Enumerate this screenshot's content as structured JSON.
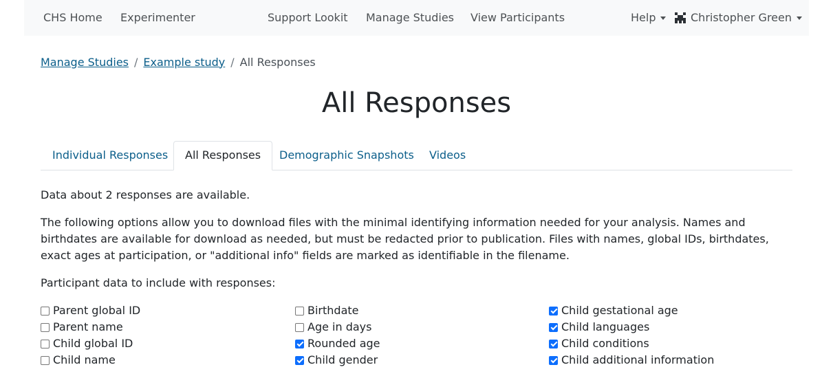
{
  "navbar": {
    "chs_home": "CHS Home",
    "experimenter": "Experimenter",
    "support": "Support Lookit",
    "manage_studies": "Manage Studies",
    "view_participants": "View Participants",
    "help": "Help",
    "user_name": "Christopher Green"
  },
  "breadcrumb": {
    "item1": "Manage Studies",
    "item2": "Example study",
    "current": "All Responses",
    "separator": "/"
  },
  "page_title": "All Responses",
  "tabs": [
    {
      "label": "Individual Responses",
      "active": false
    },
    {
      "label": "All Responses",
      "active": true
    },
    {
      "label": "Demographic Snapshots",
      "active": false
    },
    {
      "label": "Videos",
      "active": false
    }
  ],
  "summary": "Data about 2 responses are available.",
  "description": "The following options allow you to download files with the minimal identifying information needed for your analysis. Names and birthdates are available for download as needed, but must be redacted prior to publication. Files with names, global IDs, birthdates, exact ages at participation, or \"additional info\" fields are marked as identifiable in the filename.",
  "include_label": "Participant data to include with responses:",
  "options": {
    "col1": [
      {
        "label": "Parent global ID",
        "checked": false
      },
      {
        "label": "Parent name",
        "checked": false
      },
      {
        "label": "Child global ID",
        "checked": false
      },
      {
        "label": "Child name",
        "checked": false
      }
    ],
    "col2": [
      {
        "label": "Birthdate",
        "checked": false
      },
      {
        "label": "Age in days",
        "checked": false
      },
      {
        "label": "Rounded age",
        "checked": true
      },
      {
        "label": "Child gender",
        "checked": true
      }
    ],
    "col3": [
      {
        "label": "Child gestational age",
        "checked": true
      },
      {
        "label": "Child languages",
        "checked": true
      },
      {
        "label": "Child conditions",
        "checked": true
      },
      {
        "label": "Child additional information",
        "checked": true
      }
    ]
  },
  "colors": {
    "navbar_bg": "#f8f9fa",
    "link": "#0b5e8a",
    "checkbox_checked": "#0d6efd",
    "text": "#212529"
  },
  "icons": {
    "user": "user-avatar-icon",
    "dropdown": "chevron-down-icon"
  }
}
